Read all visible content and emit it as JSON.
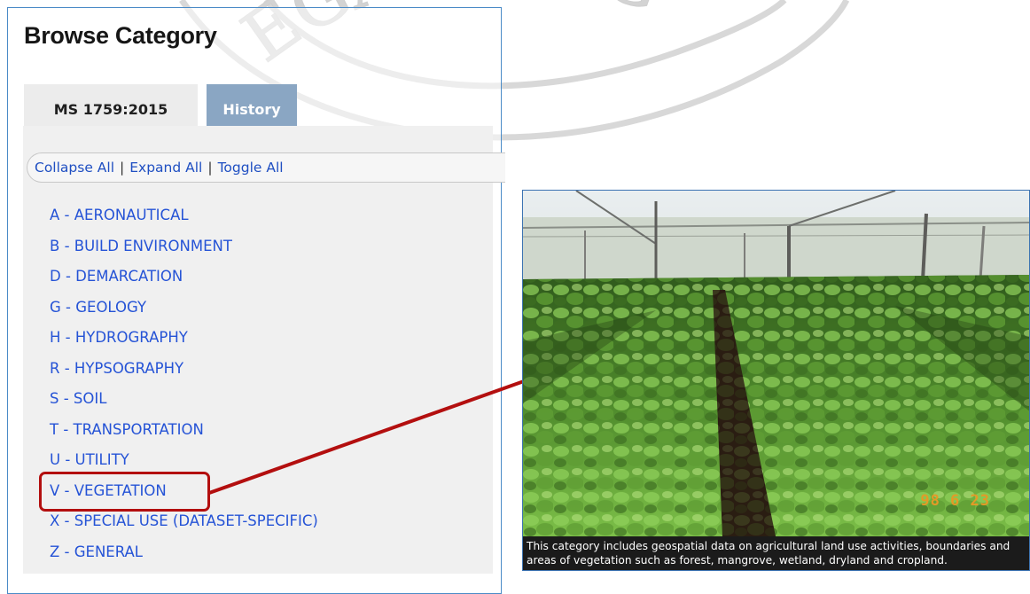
{
  "panel": {
    "title": "Browse Category",
    "tabs": [
      {
        "label": "MS 1759:2015",
        "active": true
      },
      {
        "label": "History",
        "active": false
      }
    ]
  },
  "tree_controls": {
    "collapse_all": "Collapse All",
    "expand_all": "Expand All",
    "toggle_all": "Toggle All",
    "separator": "|"
  },
  "categories": [
    "A - AERONAUTICAL",
    "B - BUILD ENVIRONMENT",
    "D - DEMARCATION",
    "G - GEOLOGY",
    "H - HYDROGRAPHY",
    "R - HYPSOGRAPHY",
    "S - SOIL",
    "T - TRANSPORTATION",
    "U - UTILITY",
    "V - VEGETATION",
    "X - SPECIAL USE (DATASET-SPECIFIC)",
    "Z - GENERAL"
  ],
  "highlighted_category": "V - VEGETATION",
  "preview": {
    "date_stamp": "98 6 23",
    "caption_line1": "This category includes geospatial data on agricultural land use activities, boundaries and",
    "caption_line2": "areas of vegetation such as forest, mangrove, wetland, dryland and cropland."
  },
  "watermark": {
    "text": "EGARA (PG"
  },
  "colors": {
    "link": "#2553d6",
    "highlight": "#b30f0f",
    "panel_border": "#4a8bc7",
    "tab_history": "#8aa6c3"
  }
}
